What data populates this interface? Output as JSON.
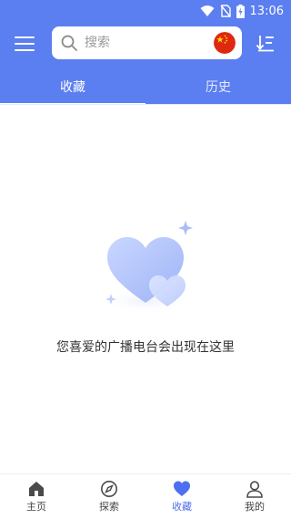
{
  "status_bar": {
    "time": "13:06"
  },
  "search": {
    "placeholder": "搜索"
  },
  "tabs": [
    {
      "label": "收藏",
      "active": true
    },
    {
      "label": "历史",
      "active": false
    }
  ],
  "empty_state": {
    "message": "您喜爱的广播电台会出现在这里"
  },
  "bottom_nav": [
    {
      "label": "主页",
      "icon": "home-icon",
      "active": false
    },
    {
      "label": "探索",
      "icon": "compass-icon",
      "active": false
    },
    {
      "label": "收藏",
      "icon": "heart-icon",
      "active": true
    },
    {
      "label": "我的",
      "icon": "person-icon",
      "active": false
    }
  ],
  "colors": {
    "primary": "#5b7ef0",
    "active_nav": "#4d6ff0",
    "background": "#ffffff"
  }
}
